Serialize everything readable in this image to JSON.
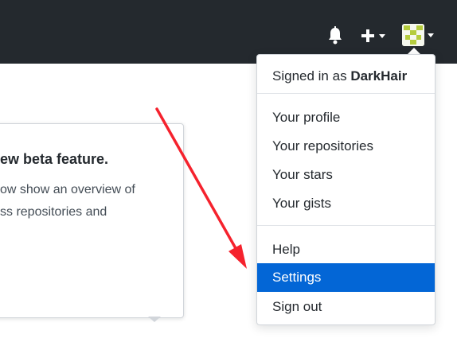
{
  "colors": {
    "header_bg": "#24292e",
    "active_item_bg": "#0366d6",
    "annotation_arrow": "#f5222d"
  },
  "header": {
    "icons": [
      "bell-icon",
      "plus-icon",
      "avatar"
    ]
  },
  "popover": {
    "title": "ew beta feature.",
    "line1": "ow show an overview of",
    "line2": "ss repositories and"
  },
  "dropdown": {
    "signed_in_prefix": "Signed in as",
    "username": "DarkHair",
    "items": [
      {
        "label": "Your profile"
      },
      {
        "label": "Your repositories"
      },
      {
        "label": "Your stars"
      },
      {
        "label": "Your gists"
      },
      {
        "label": "Help"
      },
      {
        "label": "Settings",
        "active": true
      },
      {
        "label": "Sign out"
      }
    ]
  }
}
